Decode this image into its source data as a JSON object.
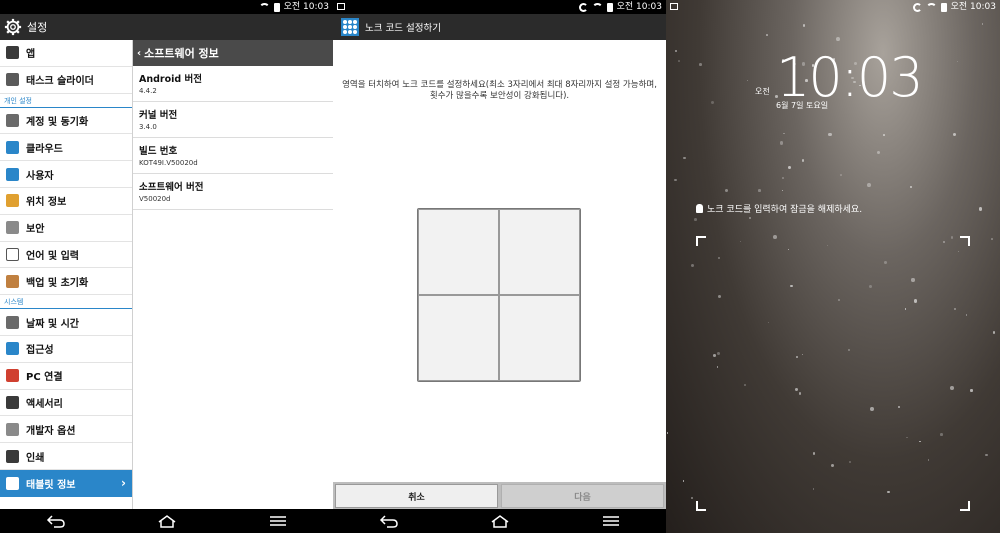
{
  "status": {
    "time": "오전 10:03"
  },
  "settings": {
    "title": "설정",
    "sections": {
      "personal": "개인 설정",
      "system": "시스템"
    },
    "items_top": [
      {
        "label": "앱",
        "icon": "apps-icon",
        "color": "#3a3a3a"
      },
      {
        "label": "태스크 슬라이더",
        "icon": "task-slider-icon",
        "color": "#5a5a5a"
      }
    ],
    "items_personal": [
      {
        "label": "계정 및 동기화",
        "icon": "account-sync-icon",
        "color": "#6a6a6a"
      },
      {
        "label": "클라우드",
        "icon": "cloud-icon",
        "color": "#2a86c9"
      },
      {
        "label": "사용자",
        "icon": "user-icon",
        "color": "#2a86c9"
      },
      {
        "label": "위치 정보",
        "icon": "location-icon",
        "color": "#e0a030"
      },
      {
        "label": "보안",
        "icon": "lock-icon",
        "color": "#8a8a8a"
      },
      {
        "label": "언어 및 입력",
        "icon": "language-icon",
        "color": "#ffffff"
      },
      {
        "label": "백업 및 초기화",
        "icon": "backup-icon",
        "color": "#c08040"
      }
    ],
    "items_system": [
      {
        "label": "날짜 및 시간",
        "icon": "clock-icon",
        "color": "#6a6a6a"
      },
      {
        "label": "접근성",
        "icon": "accessibility-icon",
        "color": "#2a86c9"
      },
      {
        "label": "PC 연결",
        "icon": "pc-connection-icon",
        "color": "#d04030"
      },
      {
        "label": "액세서리",
        "icon": "accessory-icon",
        "color": "#3a3a3a"
      },
      {
        "label": "개발자 옵션",
        "icon": "developer-icon",
        "color": "#8a8a8a"
      },
      {
        "label": "인쇄",
        "icon": "print-icon",
        "color": "#3a3a3a"
      }
    ],
    "active_item": {
      "label": "태블릿 정보",
      "icon": "tablet-info-icon"
    },
    "detail": {
      "title": "소프트웨어 정보",
      "rows": [
        {
          "title": "Android 버전",
          "value": "4.4.2"
        },
        {
          "title": "커널 버전",
          "value": "3.4.0"
        },
        {
          "title": "빌드 번호",
          "value": "KOT49I.V50020d"
        },
        {
          "title": "소프트웨어 버전",
          "value": "V50020d"
        }
      ]
    }
  },
  "knock": {
    "title": "노크 코드 설정하기",
    "description": "영역을 터치하여 노크 코드를 설정하세요(최소 3자리에서 최대 8자리까지 설정 가능하며, 횟수가 많을수록 보안성이 강화됩니다).",
    "cancel": "취소",
    "next": "다음"
  },
  "lockscreen": {
    "time": "10:03",
    "ampm": "오전",
    "date": "6월 7일 토요일",
    "message": "노크 코드를 입력하여 잠금을 해제하세요."
  },
  "colors": {
    "accent": "#2a86c9",
    "header": "#2b2b2b"
  }
}
